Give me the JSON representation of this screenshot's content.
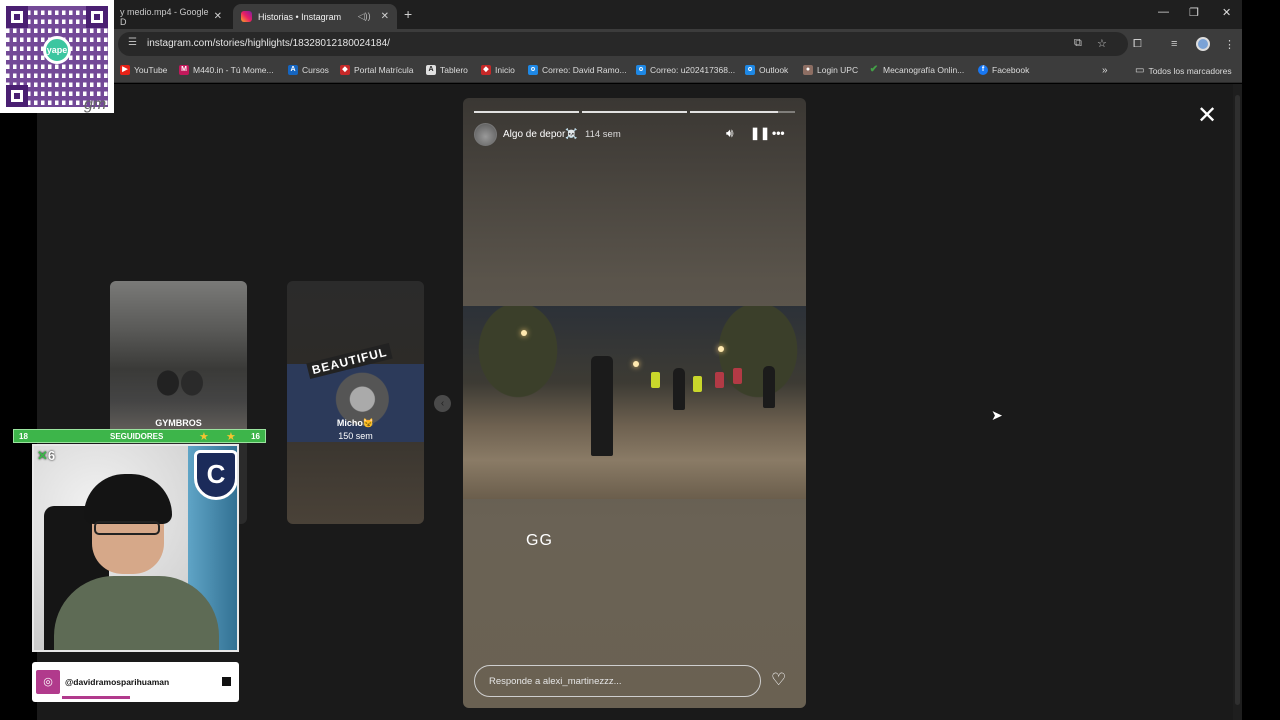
{
  "browser": {
    "tabs": [
      {
        "title": "y medio.mp4 - Google D"
      },
      {
        "title": "Historias • Instagram"
      }
    ],
    "url": "instagram.com/stories/highlights/18328012180024184/",
    "bookmarks": [
      {
        "label": "YouTube",
        "color": "#e62117",
        "glyph": "▶"
      },
      {
        "label": "M440.in - Tú Mome...",
        "color": "#c2185b",
        "glyph": "M"
      },
      {
        "label": "Cursos",
        "color": "#1565c0",
        "glyph": "A"
      },
      {
        "label": "Portal Matrícula",
        "color": "#c62828",
        "glyph": "◆"
      },
      {
        "label": "Tablero",
        "color": "#e0e0e0",
        "glyph": "A"
      },
      {
        "label": "Inicio",
        "color": "#c62828",
        "glyph": "◆"
      },
      {
        "label": "Correo: David Ramo...",
        "color": "#1e88e5",
        "glyph": "o"
      },
      {
        "label": "Correo: u202417368...",
        "color": "#1e88e5",
        "glyph": "o"
      },
      {
        "label": "Outlook",
        "color": "#1e88e5",
        "glyph": "o"
      },
      {
        "label": "Login UPC",
        "color": "#8d6e63",
        "glyph": "●"
      },
      {
        "label": "Mecanografía Onlin...",
        "color": "#43a047",
        "glyph": "✔"
      },
      {
        "label": "Facebook",
        "color": "#1877f2",
        "glyph": "f"
      }
    ],
    "all_bookmarks": "Todos los marcadores"
  },
  "stories": {
    "side_cards": [
      {
        "label": "GYMBROS"
      },
      {
        "label": "Micho😼",
        "time": "150 sem",
        "sticker": "BEAUTIFUL"
      }
    ],
    "current": {
      "username": "Algo de depor☠️",
      "time": "114 sem",
      "caption": "GG",
      "reply_placeholder": "Responde a alexi_martinezzz..."
    }
  },
  "overlay": {
    "qr_brand": "yape",
    "followers": {
      "left": "18",
      "label": "SEGUIDORES",
      "right": "16"
    },
    "webcam_badge": "6",
    "shield_letter": "C",
    "handle": "@davidramosparihuaman"
  }
}
